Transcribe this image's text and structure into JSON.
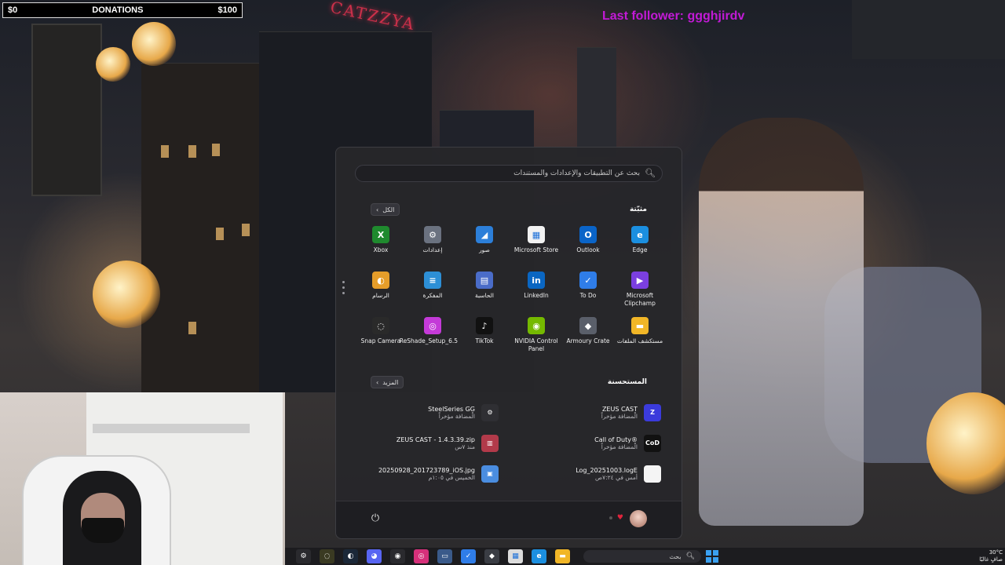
{
  "stream_overlay": {
    "donations_current": "$0",
    "donations_label": "DONATIONS",
    "donations_goal": "$100",
    "last_follower": "Last follower: ggghjirdv"
  },
  "wallpaper": {
    "neon_sign": "CATZZYA"
  },
  "start_menu": {
    "search_placeholder": "بحث عن التطبيقات والإعدادات والمستندات",
    "pinned_title": "مثبّتة",
    "all_button": "الكل",
    "pinned_apps": [
      {
        "label": "Edge",
        "icon": "edge-icon",
        "glyph": "e",
        "color": "#1b8fe0"
      },
      {
        "label": "Outlook",
        "icon": "outlook-icon",
        "glyph": "O",
        "color": "#0a64c8"
      },
      {
        "label": "Microsoft Store",
        "icon": "store-icon",
        "glyph": "▦",
        "color": "#f2f2f2"
      },
      {
        "label": "صور",
        "icon": "photos-icon",
        "glyph": "◢",
        "color": "#2c7fd9"
      },
      {
        "label": "إعدادات",
        "icon": "settings-icon",
        "glyph": "⚙",
        "color": "#6b7280"
      },
      {
        "label": "Xbox",
        "icon": "xbox-icon",
        "glyph": "X",
        "color": "#1f8a2e"
      },
      {
        "label": "Microsoft Clipchamp",
        "icon": "clipchamp-icon",
        "glyph": "▶",
        "color": "#7b3fe0"
      },
      {
        "label": "To Do",
        "icon": "todo-icon",
        "glyph": "✓",
        "color": "#2f7de8"
      },
      {
        "label": "LinkedIn",
        "icon": "linkedin-icon",
        "glyph": "in",
        "color": "#0a66c2"
      },
      {
        "label": "الحاسبة",
        "icon": "calculator-icon",
        "glyph": "▤",
        "color": "#4a6cc8"
      },
      {
        "label": "المفكرة",
        "icon": "notepad-icon",
        "glyph": "≡",
        "color": "#2d8fd6"
      },
      {
        "label": "الرسام",
        "icon": "paint-icon",
        "glyph": "◐",
        "color": "#e59d2a"
      },
      {
        "label": "مستكشف الملفات",
        "icon": "file-explorer-icon",
        "glyph": "▬",
        "color": "#f1b627"
      },
      {
        "label": "Armoury Crate",
        "icon": "armoury-crate-icon",
        "glyph": "◆",
        "color": "#5a5f6a"
      },
      {
        "label": "NVIDIA Control Panel",
        "icon": "nvidia-icon",
        "glyph": "◉",
        "color": "#75b900"
      },
      {
        "label": "TikTok",
        "icon": "tiktok-icon",
        "glyph": "♪",
        "color": "#111111"
      },
      {
        "label": "ReShade_Setup_6.5",
        "icon": "reshade-icon",
        "glyph": "◎",
        "color": "#c43ad8"
      },
      {
        "label": "Snap Camera",
        "icon": "snap-camera-icon",
        "glyph": "◌",
        "color": "#2a2a2a"
      }
    ],
    "recommended_title": "المستحسنة",
    "more_button": "المزيد",
    "recommended": [
      {
        "name": "ZEUS CAST",
        "sub": "الْمضافة مؤخراً",
        "icon": "zeus-cast-icon",
        "glyph": "Z",
        "color": "#3b3bdc"
      },
      {
        "name": "SteelSeries GG",
        "sub": "الْمضافة مؤخراً",
        "icon": "steelseries-icon",
        "glyph": "⚙",
        "color": "#2f2f33"
      },
      {
        "name": "Call of Duty®",
        "sub": "الْمضافة مؤخراً",
        "icon": "call-of-duty-icon",
        "glyph": "CoD",
        "color": "#111111"
      },
      {
        "name": "ZEUS CAST - 1.4.3.39.zip",
        "sub": "منذ ٧س",
        "icon": "winrar-icon",
        "glyph": "▥",
        "color": "#b23a4a"
      },
      {
        "name": "Log_20251003.logE",
        "sub": "أمس في ٧:٢٤ص",
        "icon": "file-icon",
        "glyph": "",
        "color": "#f4f4f4"
      },
      {
        "name": "20250928_201723789_iOS.jpg",
        "sub": "الخميس في ١:٠٥م",
        "icon": "image-file-icon",
        "glyph": "▣",
        "color": "#4a8de0"
      }
    ]
  },
  "taskbar": {
    "search_text": "بحث",
    "pinned": [
      {
        "icon": "steelseries-icon",
        "glyph": "⚙",
        "color": "#2a2a2e"
      },
      {
        "icon": "snap-camera-icon",
        "glyph": "◌",
        "color": "#3a3a22"
      },
      {
        "icon": "steam-icon",
        "glyph": "◐",
        "color": "#1b2838"
      },
      {
        "icon": "discord-icon",
        "glyph": "◕",
        "color": "#5865f2"
      },
      {
        "icon": "obs-icon",
        "glyph": "◉",
        "color": "#2a2a2e"
      },
      {
        "icon": "instagram-icon",
        "glyph": "◎",
        "color": "#d6307a"
      },
      {
        "icon": "app-window-icon",
        "glyph": "▭",
        "color": "#3a5a8a"
      },
      {
        "icon": "todo-icon",
        "glyph": "✓",
        "color": "#2f7de8"
      },
      {
        "icon": "armoury-crate-icon",
        "glyph": "◆",
        "color": "#3a3d44"
      },
      {
        "icon": "store-icon",
        "glyph": "▦",
        "color": "#dcdcdc"
      },
      {
        "icon": "edge-icon",
        "glyph": "e",
        "color": "#1b8fe0"
      },
      {
        "icon": "file-explorer-icon",
        "glyph": "▬",
        "color": "#f1b627"
      }
    ],
    "temperature": "30°C",
    "weather_text": "صافٍ غالبًا"
  }
}
